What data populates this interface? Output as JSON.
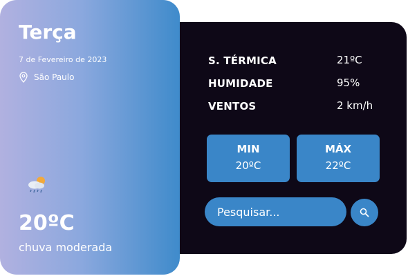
{
  "weather": {
    "day": "Terça",
    "date": "7 de Fevereiro de 2023",
    "location": "São Paulo",
    "temperature": "20ºC",
    "description": "chuva moderada",
    "icon": "rain-cloud-icon"
  },
  "stats": [
    {
      "label": "S. TÉRMICA",
      "value": "21ºC"
    },
    {
      "label": "HUMIDADE",
      "value": "95%"
    },
    {
      "label": "VENTOS",
      "value": "2 km/h"
    }
  ],
  "range": {
    "min_label": "MIN",
    "min_value": "20ºC",
    "max_label": "MÁX",
    "max_value": "22ºC"
  },
  "search": {
    "placeholder": "Pesquisar...",
    "icon": "search-icon"
  },
  "colors": {
    "accent": "#3a86c8",
    "panel_bg": "#0e0817",
    "card_gradient_start": "#b1b1e0",
    "card_gradient_end": "#3f8bcb"
  }
}
